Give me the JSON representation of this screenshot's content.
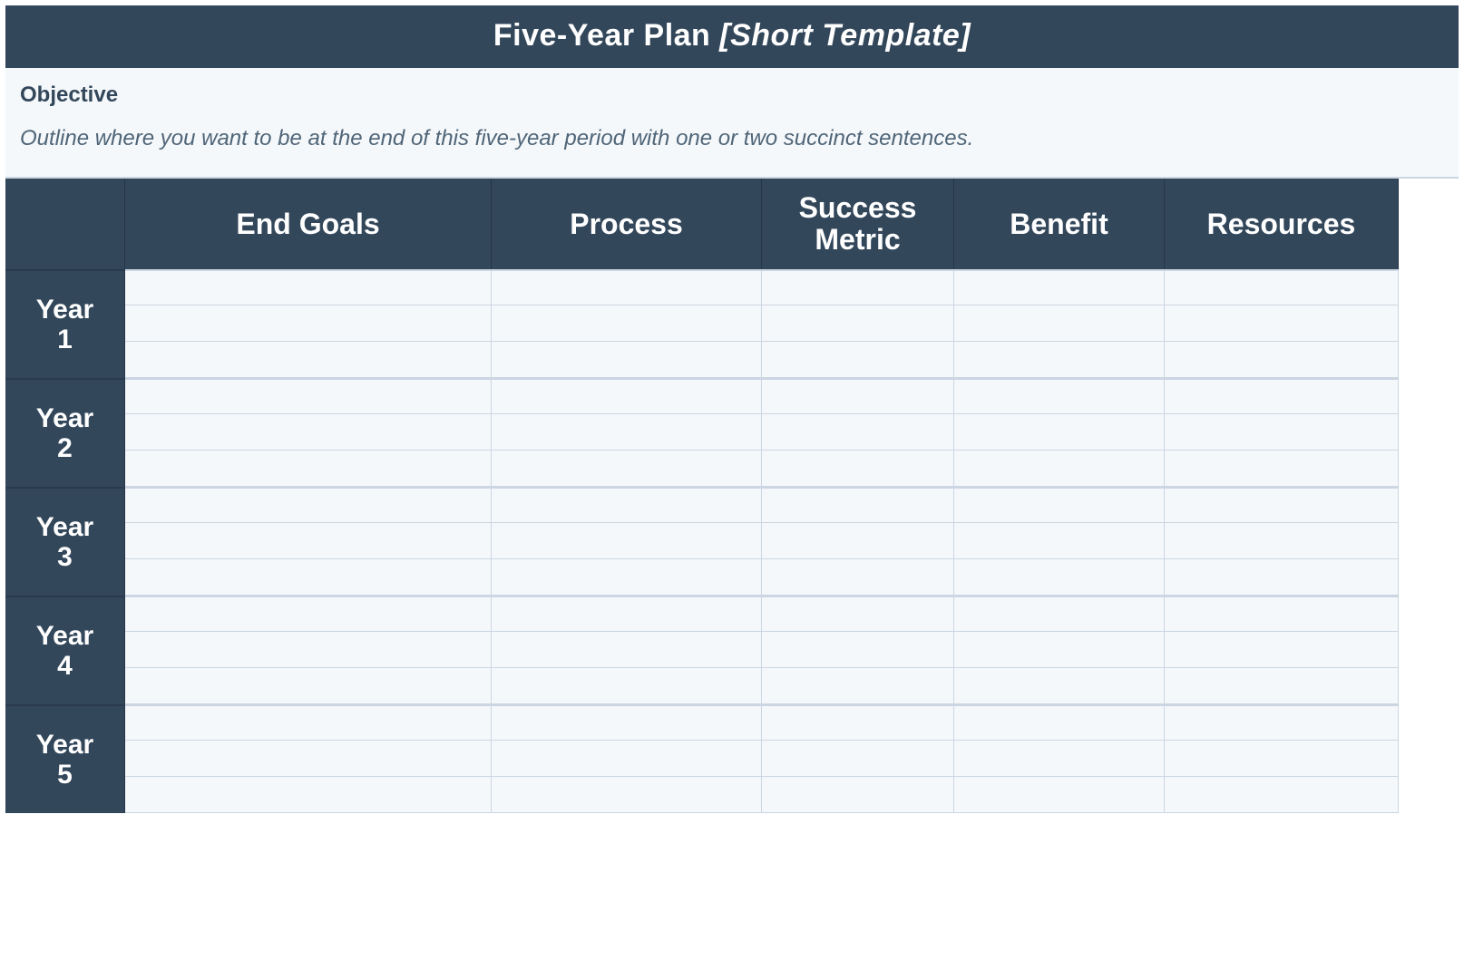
{
  "header": {
    "title_main": "Five-Year Plan ",
    "title_suffix": "[Short Template]"
  },
  "objective": {
    "label": "Objective",
    "description": "Outline where you want to be at the end of this five-year period with one or two succinct sentences."
  },
  "columns": [
    "End Goals",
    "Process",
    "Success Metric",
    "Benefit",
    "Resources"
  ],
  "years": [
    {
      "label_line1": "Year",
      "label_line2": "1",
      "rows": [
        {
          "end_goals": "",
          "process": "",
          "success_metric": "",
          "benefit": "",
          "resources": ""
        },
        {
          "end_goals": "",
          "process": "",
          "success_metric": "",
          "benefit": "",
          "resources": ""
        },
        {
          "end_goals": "",
          "process": "",
          "success_metric": "",
          "benefit": "",
          "resources": ""
        }
      ]
    },
    {
      "label_line1": "Year",
      "label_line2": "2",
      "rows": [
        {
          "end_goals": "",
          "process": "",
          "success_metric": "",
          "benefit": "",
          "resources": ""
        },
        {
          "end_goals": "",
          "process": "",
          "success_metric": "",
          "benefit": "",
          "resources": ""
        },
        {
          "end_goals": "",
          "process": "",
          "success_metric": "",
          "benefit": "",
          "resources": ""
        }
      ]
    },
    {
      "label_line1": "Year",
      "label_line2": "3",
      "rows": [
        {
          "end_goals": "",
          "process": "",
          "success_metric": "",
          "benefit": "",
          "resources": ""
        },
        {
          "end_goals": "",
          "process": "",
          "success_metric": "",
          "benefit": "",
          "resources": ""
        },
        {
          "end_goals": "",
          "process": "",
          "success_metric": "",
          "benefit": "",
          "resources": ""
        }
      ]
    },
    {
      "label_line1": "Year",
      "label_line2": "4",
      "rows": [
        {
          "end_goals": "",
          "process": "",
          "success_metric": "",
          "benefit": "",
          "resources": ""
        },
        {
          "end_goals": "",
          "process": "",
          "success_metric": "",
          "benefit": "",
          "resources": ""
        },
        {
          "end_goals": "",
          "process": "",
          "success_metric": "",
          "benefit": "",
          "resources": ""
        }
      ]
    },
    {
      "label_line1": "Year",
      "label_line2": "5",
      "rows": [
        {
          "end_goals": "",
          "process": "",
          "success_metric": "",
          "benefit": "",
          "resources": ""
        },
        {
          "end_goals": "",
          "process": "",
          "success_metric": "",
          "benefit": "",
          "resources": ""
        },
        {
          "end_goals": "",
          "process": "",
          "success_metric": "",
          "benefit": "",
          "resources": ""
        }
      ]
    }
  ]
}
